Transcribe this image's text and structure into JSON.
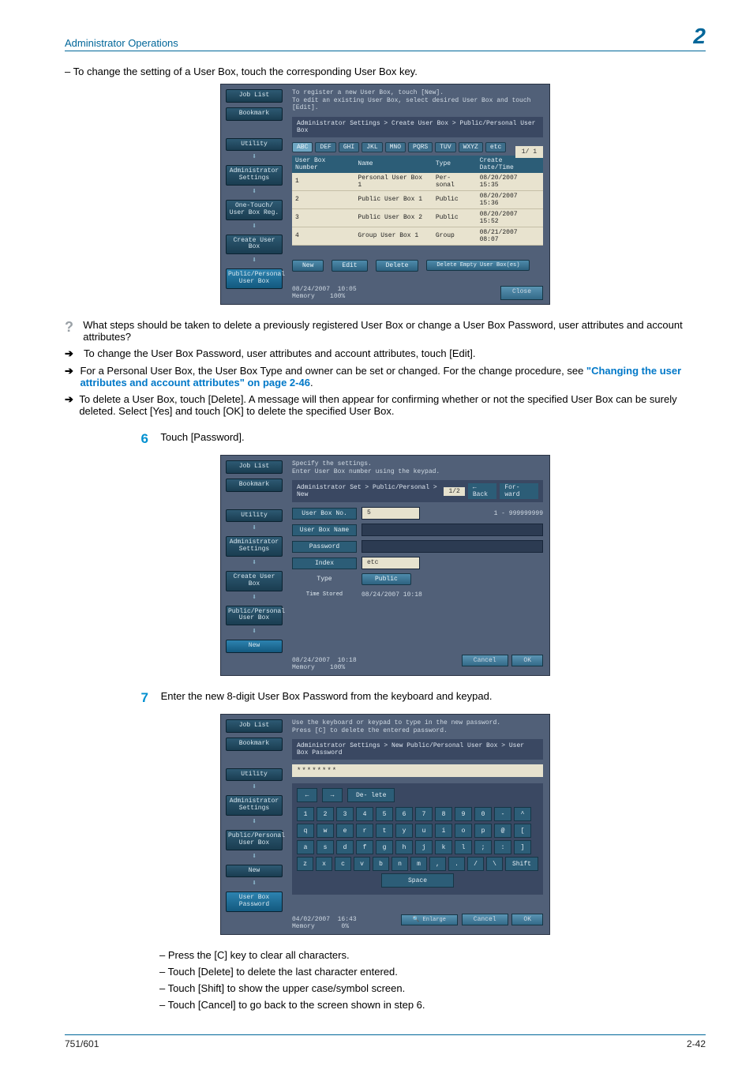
{
  "header": {
    "title": "Administrator Operations",
    "chapter": "2"
  },
  "intro_bullet": "To change the setting of a User Box, touch the corresponding User Box key.",
  "panel1": {
    "instr": "To register a new User Box, touch [New].\nTo edit an existing User Box, select desired User Box and touch [Edit].",
    "breadcrumb": "Administrator Settings > Create User Box > Public/Personal User Box",
    "side": [
      "Job List",
      "Bookmark",
      "Utility",
      "Administrator Settings",
      "One-Touch/ User Box Reg.",
      "Create User Box",
      "Public/Personal User Box"
    ],
    "indextabs": [
      "ABC",
      "DEF",
      "GHI",
      "JKL",
      "MNO",
      "PQRS",
      "TUV",
      "WXYZ",
      "etc"
    ],
    "columns": [
      "User Box Number",
      "Name",
      "Type",
      "Create Date/Time"
    ],
    "rows": [
      {
        "num": "1",
        "name": "Personal User Box 1",
        "type": "Per- sonal",
        "date": "08/20/2007 15:35"
      },
      {
        "num": "2",
        "name": "Public User Box 1",
        "type": "Public",
        "date": "08/20/2007 15:36"
      },
      {
        "num": "3",
        "name": "Public User Box 2",
        "type": "Public",
        "date": "08/20/2007 15:52"
      },
      {
        "num": "4",
        "name": "Group User Box 1",
        "type": "Group",
        "date": "08/21/2007 08:07"
      }
    ],
    "pager": "1/  1",
    "buttons": {
      "new": "New",
      "edit": "Edit",
      "delete": "Delete",
      "delete_empty": "Delete Empty User Box(es)"
    },
    "status_date": "08/24/2007",
    "status_time": "10:05",
    "status_mem": "Memory",
    "status_pct": "100%",
    "close": "Close"
  },
  "qa": {
    "question": "What steps should be taken to delete a previously registered User Box or change a User Box Password, user attributes and account attributes?",
    "arrows": [
      "To change the User Box Password, user attributes and account attributes, touch [Edit].",
      "For a Personal User Box, the User Box Type and owner can be set or changed. For the change procedure, see ",
      "To delete a User Box, touch [Delete]. A message will then appear for confirming whether or not the specified User Box can be surely deleted. Select [Yes] and touch [OK] to delete the specified User Box."
    ],
    "link": "\"Changing the user attributes and account attributes\" on page 2-46",
    "link_suffix": "."
  },
  "step6": {
    "num": "6",
    "text": "Touch [Password]."
  },
  "panel2": {
    "instr": "Specify the settings.\nEnter User Box number using the keypad.",
    "breadcrumb": "Administrator Set > Public/Personal > New",
    "page": "1/2",
    "back": "Back",
    "forward": "For- ward",
    "side": [
      "Job List",
      "Bookmark",
      "Utility",
      "Administrator Settings",
      "Create User Box",
      "Public/Personal User Box",
      "New"
    ],
    "fields": {
      "userboxno_l": "User Box No.",
      "userboxno_v": "5",
      "range": "1 - 999999999",
      "userboxname_l": "User Box Name",
      "password_l": "Password",
      "index_l": "Index",
      "index_v": "etc",
      "type_l": "Type",
      "type_v": "Public",
      "time_l": "Time Stored",
      "time_v": "08/24/2007  10:18"
    },
    "status_date": "08/24/2007",
    "status_time": "10:18",
    "status_mem": "Memory",
    "status_pct": "100%",
    "cancel": "Cancel",
    "ok": "OK"
  },
  "step7": {
    "num": "7",
    "text": "Enter the new 8-digit User Box Password from the keyboard and keypad."
  },
  "panel3": {
    "instr": "Use the keyboard or keypad to type in the new password.\nPress [C] to delete the entered password.",
    "breadcrumb": "Administrator Settings > New Public/Personal User Box > User Box Password",
    "pw_mask": "********",
    "delete": "De- lete",
    "side": [
      "Job List",
      "Bookmark",
      "Utility",
      "Administrator Settings",
      "Public/Personal User Box",
      "New",
      "User Box Password"
    ],
    "row1": [
      "1",
      "2",
      "3",
      "4",
      "5",
      "6",
      "7",
      "8",
      "9",
      "0",
      "-",
      "^"
    ],
    "row2": [
      "q",
      "w",
      "e",
      "r",
      "t",
      "y",
      "u",
      "i",
      "o",
      "p",
      "@",
      "["
    ],
    "row3": [
      "a",
      "s",
      "d",
      "f",
      "g",
      "h",
      "j",
      "k",
      "l",
      ";",
      ":",
      "]"
    ],
    "row4": [
      "z",
      "x",
      "c",
      "v",
      "b",
      "n",
      "m",
      ",",
      ".",
      "/",
      "\\"
    ],
    "shift": "Shift",
    "space": "Space",
    "enlarge": "Enlarge",
    "status_date": "04/02/2007",
    "status_time": "16:43",
    "status_mem": "Memory",
    "status_pct": "0%",
    "cancel": "Cancel",
    "ok": "OK"
  },
  "foot_bullets": [
    "Press the [C] key to clear all characters.",
    "Touch [Delete] to delete the last character entered.",
    "Touch [Shift] to show the upper case/symbol screen.",
    "Touch [Cancel] to go back to the screen shown in step 6."
  ],
  "footer": {
    "left": "751/601",
    "right": "2-42"
  }
}
